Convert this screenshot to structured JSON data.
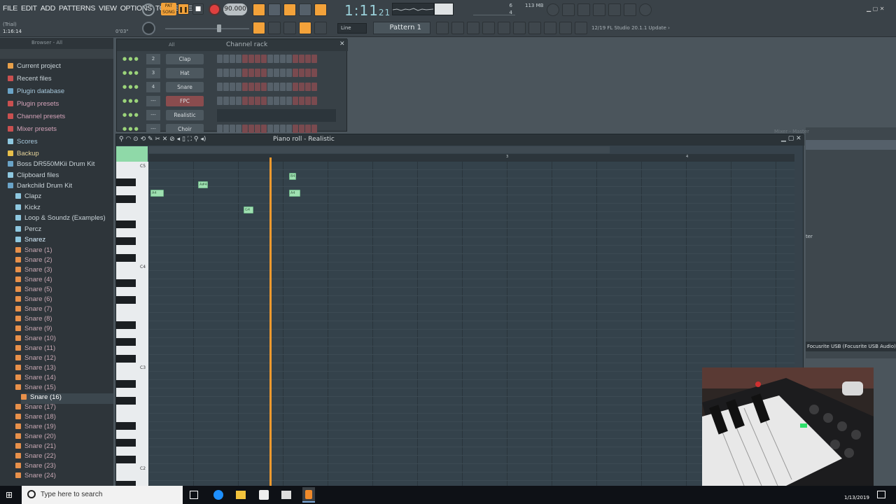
{
  "menu": [
    "FILE",
    "EDIT",
    "ADD",
    "PATTERNS",
    "VIEW",
    "OPTIONS",
    "TOOLS",
    "HELP"
  ],
  "transport": {
    "tempo": "90.000",
    "time": "1:11",
    "time_small": "21",
    "pat_label": "PAT",
    "song_label": "SONG",
    "mem": "113 MB",
    "cpu_a": "6",
    "cpu_b": "4"
  },
  "toolbar2": {
    "snap": "Line",
    "pattern": "Pattern 1",
    "news": "12/19  FL Studio 20.1.1 Update ›"
  },
  "hint": {
    "trial": "(Trial)",
    "pos": "1:16:14",
    "time": "0'03\""
  },
  "browser": {
    "header": "Browser - All",
    "items": [
      "Current project",
      "Recent files",
      "Plugin database",
      "Plugin presets",
      "Channel presets",
      "Mixer presets",
      "Scores",
      "Backup",
      "Boss DR550MKii Drum Kit",
      "Clipboard files",
      "Darkchild Drum Kit",
      "Clapz",
      "Kickz",
      "Loop & Soundz (Examples)",
      "Percz",
      "Snarez"
    ],
    "snares": [
      "Snare (1)",
      "Snare (2)",
      "Snare (3)",
      "Snare (4)",
      "Snare (5)",
      "Snare (6)",
      "Snare (7)",
      "Snare (8)",
      "Snare (9)",
      "Snare (10)",
      "Snare (11)",
      "Snare (12)",
      "Snare (13)",
      "Snare (14)",
      "Snare (15)",
      "Snare (16)",
      "Snare (17)",
      "Snare (18)",
      "Snare (19)",
      "Snare (20)",
      "Snare (21)",
      "Snare (22)",
      "Snare (23)",
      "Snare (24)"
    ]
  },
  "channel_rack": {
    "title": "Channel rack",
    "filter": "All",
    "channels": [
      {
        "num": "2",
        "name": "Clap"
      },
      {
        "num": "3",
        "name": "Hat"
      },
      {
        "num": "4",
        "name": "Snare"
      },
      {
        "num": "---",
        "name": "FPC"
      },
      {
        "num": "---",
        "name": "Realistic"
      },
      {
        "num": "---",
        "name": "Choir"
      }
    ]
  },
  "piano_roll": {
    "title": "Piano roll - Realistic",
    "bar3": "3",
    "bar4": "4",
    "key_c5": "C5",
    "key_c4": "C4",
    "key_c3": "C3",
    "key_c2": "C2",
    "notes": [
      "A4",
      "A#4",
      "G4",
      "B4",
      "A4"
    ]
  },
  "mixer": {
    "title": "Mixer - Master",
    "device": "Focusrite USB (Focusrite USB Audio)",
    "insert_label": "ter"
  },
  "taskbar": {
    "search": "Type here to search",
    "date": "1/13/2019"
  }
}
